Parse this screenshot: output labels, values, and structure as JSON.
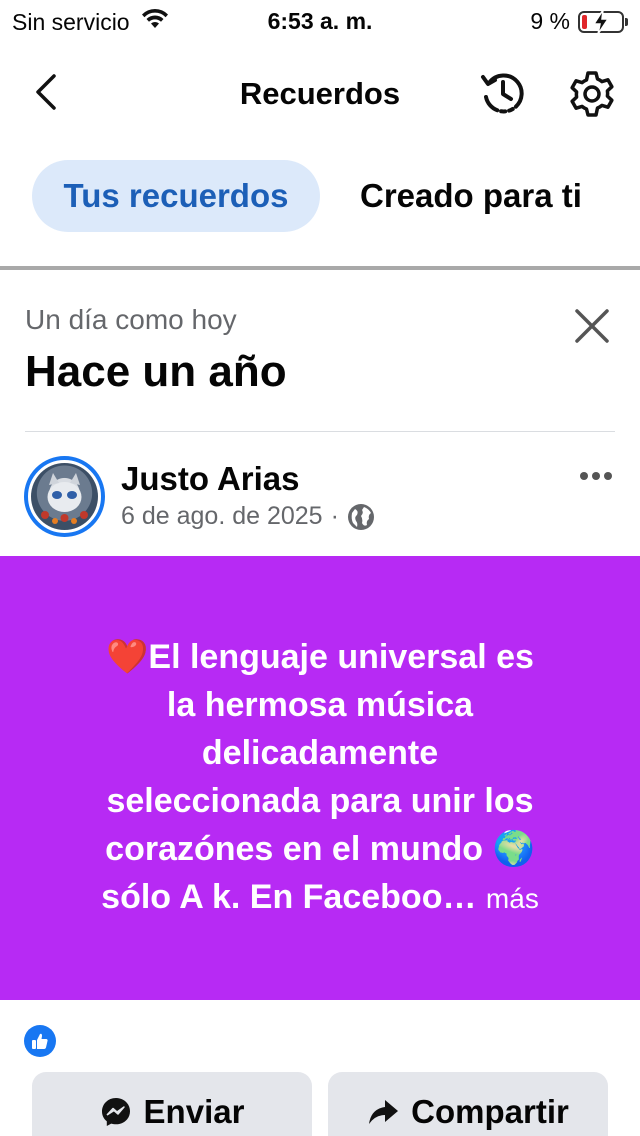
{
  "status_bar": {
    "carrier": "Sin servicio",
    "time": "6:53 a. m.",
    "battery": "9 %"
  },
  "header": {
    "title": "Recuerdos"
  },
  "tabs": [
    {
      "label": "Tus recuerdos",
      "active": true
    },
    {
      "label": "Creado para ti",
      "active": false
    }
  ],
  "memory": {
    "subtitle": "Un día como hoy",
    "title": "Hace un año"
  },
  "post": {
    "author": "Justo Arias",
    "date": "6 de ago. de 2025",
    "separator": "·",
    "text_line_1": "El lenguaje universal es",
    "text_line_2": "la hermosa música",
    "text_line_3": "delicadamente",
    "text_line_4": "seleccionada para unir los",
    "text_line_5": "corazónes en el mundo",
    "text_line_6": "sólo  A k. En Faceboo…",
    "more_label": "más",
    "background_color": "#b72af4",
    "emoji_heart": "❤️",
    "emoji_globe": "🌍"
  },
  "actions": {
    "send_label": "Enviar",
    "share_label": "Compartir"
  },
  "colors": {
    "accent": "#1877f2",
    "active_tab_bg": "#dce9fa",
    "active_tab_text": "#1c5fb7",
    "battery_low": "#e0262a"
  }
}
